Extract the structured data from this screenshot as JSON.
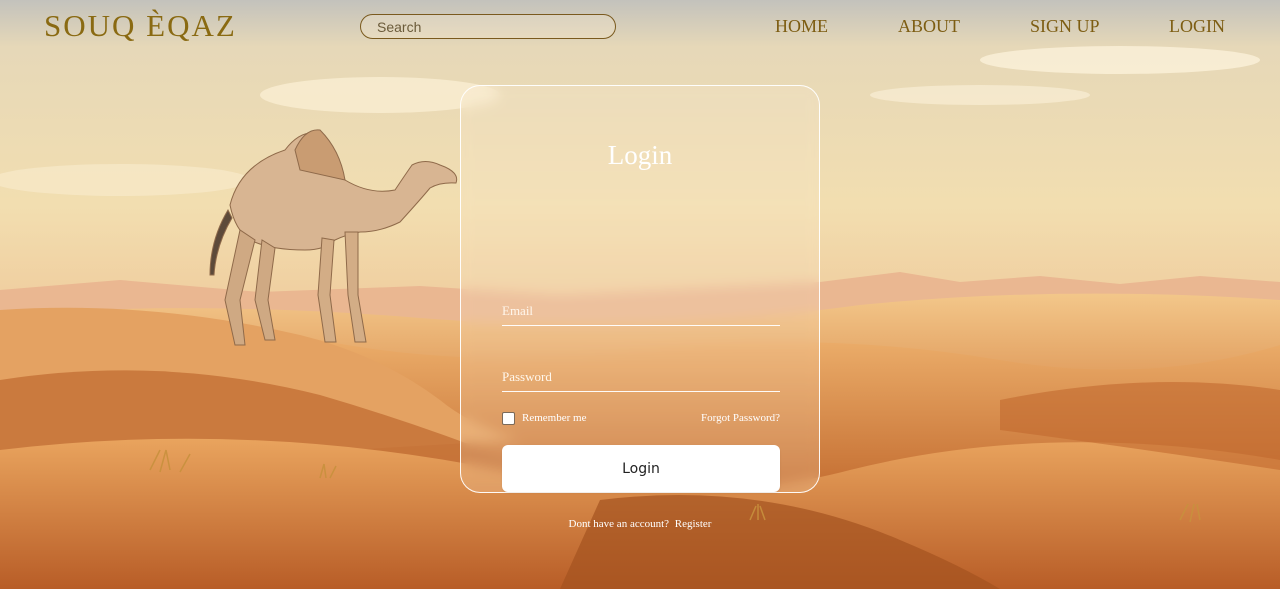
{
  "brand": {
    "logo_text": "SOUQ ÈQAZ"
  },
  "search": {
    "placeholder": "Search",
    "value": ""
  },
  "nav": {
    "items": [
      {
        "label": "HOME"
      },
      {
        "label": "ABOUT"
      },
      {
        "label": "SIGN UP"
      },
      {
        "label": "LOGIN"
      }
    ]
  },
  "login_form": {
    "title": "Login",
    "email_placeholder": "Email",
    "password_placeholder": "Password",
    "remember_label": "Remember me",
    "remember_checked": false,
    "forgot_label": "Forgot Password?",
    "submit_label": "Login",
    "register_prompt": "Dont have an account?",
    "register_link": "Register"
  },
  "colors": {
    "brand_gold": "#8a6a12",
    "nav_text": "#7d5d12",
    "card_border": "#ffffff",
    "button_bg": "#ffffff"
  },
  "background": {
    "scene": "desert dunes with camel",
    "icon": "camel-illustration"
  }
}
